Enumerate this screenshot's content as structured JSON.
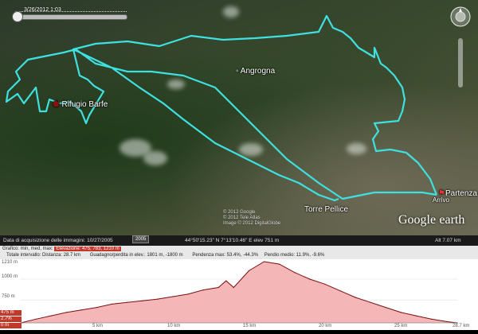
{
  "slider": {
    "date": "3/26/2012 1:03"
  },
  "map": {
    "places": [
      {
        "name": "Angrogna",
        "key": "angrogna"
      },
      {
        "name": "Rifugio Barfe",
        "key": "rifugio"
      },
      {
        "name": "Torre Pellice",
        "key": "torre"
      },
      {
        "name": "Partenza",
        "key": "partenza"
      },
      {
        "name": "Arrivo",
        "key": "arrivo"
      }
    ],
    "copyright": [
      "© 2012 Google",
      "© 2012 Tele Atlas",
      "Image © 2012 DigitalGlobe"
    ],
    "logo": {
      "brand": "Google",
      "suffix": "earth"
    },
    "track_color": "#3fe0e0"
  },
  "status": {
    "imagery_date": "Data di acquisizione delle immagini: 10/27/2005",
    "year": "2005",
    "coords": "44°50'15.23\" N   7°13'10.46\" E   elev  751 m",
    "alt": "Alt  7.07 km"
  },
  "profile_head": {
    "row1": {
      "prefix": "Grafico: min, med, max:",
      "elevation": "Elevazione: 475, 783, 1210 m"
    },
    "row2": {
      "total": "Totale intervallo:  Distanza: 28.7 km",
      "gain": "Guadagno/perdita in elev.:  1801 m, -1800 m",
      "slope": "Pendenza max: 53.4%, -44.3%",
      "mean": "Pendio medio: 11.9%, -9.6%"
    }
  },
  "profile": {
    "y_ticks": [
      "1210 m",
      "1000 m",
      "750 m",
      "475 m"
    ],
    "x_ticks": [
      "0 m",
      "5 km",
      "10 km",
      "15 km",
      "20 km",
      "25 km",
      "28.7 km"
    ],
    "badge_elev": "475 m",
    "badge_pct": "2.7%",
    "fill_color": "#f4b6b6",
    "line_color": "#7a1010"
  },
  "chart_data": {
    "type": "area",
    "x": [
      0,
      1,
      2,
      3,
      4,
      5,
      6,
      7,
      8,
      9,
      10,
      11,
      12,
      13,
      13.5,
      14,
      15,
      16,
      17,
      18,
      19,
      20,
      21,
      22,
      23,
      24,
      25,
      26,
      27,
      28,
      28.7
    ],
    "y": [
      475,
      520,
      560,
      600,
      630,
      660,
      700,
      720,
      740,
      760,
      790,
      820,
      870,
      900,
      980,
      900,
      1100,
      1210,
      1180,
      1080,
      1000,
      940,
      860,
      780,
      720,
      660,
      600,
      560,
      520,
      490,
      475
    ],
    "ylim": [
      475,
      1210
    ],
    "xlim": [
      0,
      28.7
    ]
  }
}
